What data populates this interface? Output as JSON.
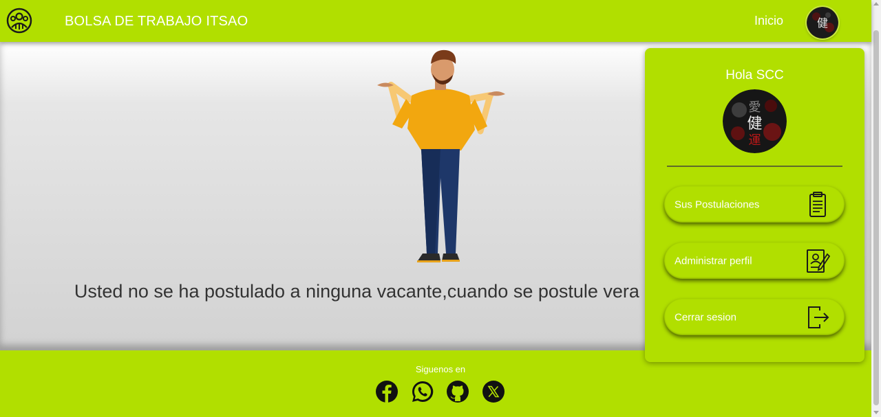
{
  "navbar": {
    "brand": "BOLSA DE TRABAJO ITSAO",
    "links": [
      "Inicio"
    ],
    "logo_icon": "people-circle-logo-icon",
    "avatar_icon": "user-avatar-kanji"
  },
  "main": {
    "illustration": "shrugging-man-illustration",
    "message": "Usted no se ha postulado a ninguna vacante,cuando se postule vera aqui lo que ha echo"
  },
  "user_menu": {
    "greeting": "Hola SCC",
    "items": [
      {
        "label": "Sus Postulaciones",
        "icon": "clipboard-list-icon"
      },
      {
        "label": "Administrar perfil",
        "icon": "profile-edit-icon"
      },
      {
        "label": "Cerrar sesion",
        "icon": "logout-icon"
      }
    ]
  },
  "footer": {
    "follow_label": "Siguenos en",
    "social": [
      "facebook-icon",
      "whatsapp-icon",
      "github-icon",
      "x-icon"
    ]
  },
  "colors": {
    "accent": "#b1df00",
    "text_light": "#ffffff",
    "text_dark": "#333333"
  }
}
